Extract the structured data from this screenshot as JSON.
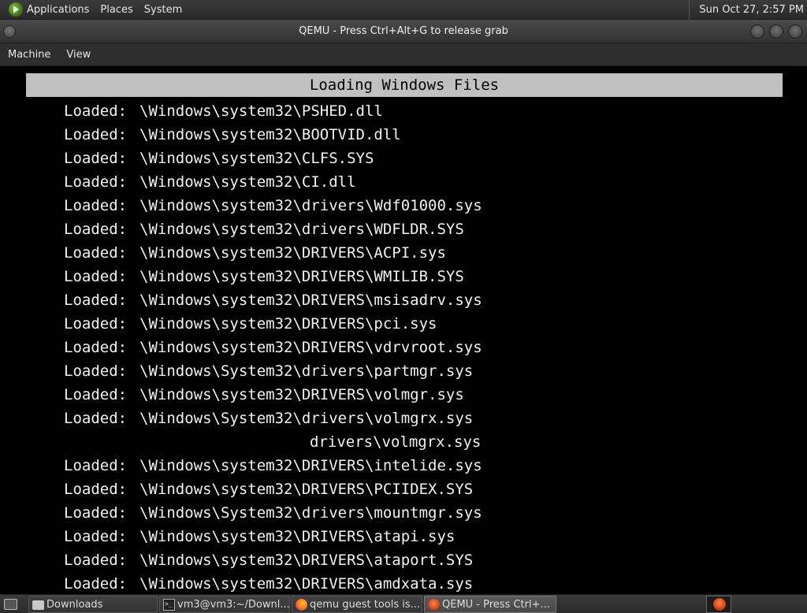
{
  "top_panel": {
    "menus": [
      "Applications",
      "Places",
      "System"
    ],
    "clock": "Sun Oct 27,  2:57 PM"
  },
  "window": {
    "title": "QEMU - Press Ctrl+Alt+G to release grab",
    "menu_bar": [
      "Machine",
      "View"
    ]
  },
  "vm": {
    "header": "Loading Windows Files",
    "lines": [
      {
        "prefix": "Loaded:",
        "path": "\\Windows\\system32\\PSHED.dll"
      },
      {
        "prefix": "Loaded:",
        "path": "\\Windows\\system32\\BOOTVID.dll"
      },
      {
        "prefix": "Loaded:",
        "path": "\\Windows\\system32\\CLFS.SYS"
      },
      {
        "prefix": "Loaded:",
        "path": "\\Windows\\system32\\CI.dll"
      },
      {
        "prefix": "Loaded:",
        "path": "\\Windows\\system32\\drivers\\Wdf01000.sys"
      },
      {
        "prefix": "Loaded:",
        "path": "\\Windows\\system32\\drivers\\WDFLDR.SYS"
      },
      {
        "prefix": "Loaded:",
        "path": "\\Windows\\system32\\DRIVERS\\ACPI.sys"
      },
      {
        "prefix": "Loaded:",
        "path": "\\Windows\\system32\\DRIVERS\\WMILIB.SYS"
      },
      {
        "prefix": "Loaded:",
        "path": "\\Windows\\system32\\DRIVERS\\msisadrv.sys"
      },
      {
        "prefix": "Loaded:",
        "path": "\\Windows\\system32\\DRIVERS\\pci.sys"
      },
      {
        "prefix": "Loaded:",
        "path": "\\Windows\\system32\\DRIVERS\\vdrvroot.sys"
      },
      {
        "prefix": "Loaded:",
        "path": "\\Windows\\System32\\drivers\\partmgr.sys"
      },
      {
        "prefix": "Loaded:",
        "path": "\\Windows\\system32\\DRIVERS\\volmgr.sys"
      },
      {
        "prefix": "Loaded:",
        "path": "\\Windows\\System32\\drivers\\volmgrx.sys"
      },
      {
        "prefix": "",
        "path": "drivers\\volmgrx.sys"
      },
      {
        "prefix": "Loaded:",
        "path": "\\Windows\\system32\\DRIVERS\\intelide.sys"
      },
      {
        "prefix": "Loaded:",
        "path": "\\Windows\\system32\\DRIVERS\\PCIIDEX.SYS"
      },
      {
        "prefix": "Loaded:",
        "path": "\\Windows\\System32\\drivers\\mountmgr.sys"
      },
      {
        "prefix": "Loaded:",
        "path": "\\Windows\\system32\\DRIVERS\\atapi.sys"
      },
      {
        "prefix": "Loaded:",
        "path": "\\Windows\\system32\\DRIVERS\\ataport.SYS"
      },
      {
        "prefix": "Loaded:",
        "path": "\\Windows\\system32\\DRIVERS\\amdxata.sys"
      }
    ]
  },
  "taskbar": {
    "items": [
      {
        "icon": "folder-icon",
        "label": "Downloads",
        "active": false
      },
      {
        "icon": "terminal-icon",
        "label": "vm3@vm3:~/Downl...",
        "active": false
      },
      {
        "icon": "firefox-icon",
        "label": "qemu guest tools is...",
        "active": false
      },
      {
        "icon": "qemu-icon",
        "label": "QEMU - Press Ctrl+...",
        "active": true
      }
    ],
    "tray_icon": "qemu-icon"
  }
}
